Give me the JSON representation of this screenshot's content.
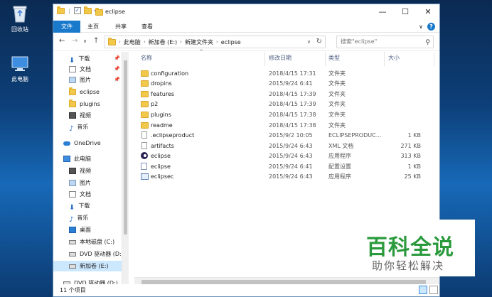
{
  "desktop": {
    "icons": [
      {
        "label": "回收站",
        "icon": "recycle-bin-icon"
      },
      {
        "label": "此电脑",
        "icon": "computer-icon"
      }
    ],
    "watermark": {
      "title": "百科全说",
      "subtitle": "助你轻松解决"
    }
  },
  "window": {
    "title": "eclipse",
    "controls": {
      "minimize": "—",
      "maximize": "☐",
      "close": "✕"
    }
  },
  "ribbon": {
    "tabs": [
      "文件",
      "主页",
      "共享",
      "查看"
    ],
    "expand_glyph": "∨",
    "help_glyph": "?"
  },
  "nav": {
    "back": "←",
    "forward": "→",
    "recent": "∨",
    "up": "↑",
    "breadcrumb": [
      "此电脑",
      "新加卷 (E:)",
      "新建文件夹",
      "eclipse"
    ],
    "refresh": "↻",
    "search_placeholder": "搜索\"eclipse\""
  },
  "sidebar": {
    "items": [
      {
        "label": "下载",
        "pinned": true
      },
      {
        "label": "文档",
        "pinned": true
      },
      {
        "label": "图片",
        "pinned": true
      },
      {
        "label": "eclipse",
        "pinned": false
      },
      {
        "label": "plugins",
        "pinned": false
      },
      {
        "label": "视频",
        "pinned": false
      },
      {
        "label": "音乐",
        "pinned": false
      },
      {
        "label": "OneDrive",
        "pinned": false
      },
      {
        "label": "此电脑",
        "pinned": false
      },
      {
        "label": "视频",
        "pinned": false
      },
      {
        "label": "图片",
        "pinned": false
      },
      {
        "label": "文档",
        "pinned": false
      },
      {
        "label": "下载",
        "pinned": false
      },
      {
        "label": "音乐",
        "pinned": false
      },
      {
        "label": "桌面",
        "pinned": false
      },
      {
        "label": "本地磁盘 (C:)",
        "pinned": false
      },
      {
        "label": "DVD 驱动器 (D:",
        "pinned": false
      },
      {
        "label": "新加卷 (E:)",
        "pinned": false,
        "selected": true
      },
      {
        "label": "DVD 驱动器 (D:)",
        "pinned": false
      }
    ]
  },
  "list": {
    "columns": {
      "name": "名称",
      "date": "修改日期",
      "type": "类型",
      "size": "大小"
    },
    "rows": [
      {
        "name": "configuration",
        "date": "2018/4/15 17:31",
        "type": "文件夹",
        "size": "",
        "icon": "folder"
      },
      {
        "name": "dropins",
        "date": "2015/9/24 6:41",
        "type": "文件夹",
        "size": "",
        "icon": "folder"
      },
      {
        "name": "features",
        "date": "2018/4/15 17:39",
        "type": "文件夹",
        "size": "",
        "icon": "folder"
      },
      {
        "name": "p2",
        "date": "2018/4/15 17:39",
        "type": "文件夹",
        "size": "",
        "icon": "folder"
      },
      {
        "name": "plugins",
        "date": "2018/4/15 17:38",
        "type": "文件夹",
        "size": "",
        "icon": "folder"
      },
      {
        "name": "readme",
        "date": "2018/4/15 17:38",
        "type": "文件夹",
        "size": "",
        "icon": "folder"
      },
      {
        "name": ".eclipseproduct",
        "date": "2015/9/2 10:05",
        "type": "ECLIPSEPRODUC...",
        "size": "1 KB",
        "icon": "file"
      },
      {
        "name": "artifacts",
        "date": "2015/9/24 6:43",
        "type": "XML 文档",
        "size": "271 KB",
        "icon": "file"
      },
      {
        "name": "eclipse",
        "date": "2015/9/24 6:43",
        "type": "应用程序",
        "size": "313 KB",
        "icon": "eclipse"
      },
      {
        "name": "eclipse",
        "date": "2015/9/24 6:41",
        "type": "配置设置",
        "size": "1 KB",
        "icon": "ini"
      },
      {
        "name": "eclipsec",
        "date": "2015/9/24 6:43",
        "type": "应用程序",
        "size": "25 KB",
        "icon": "exe"
      }
    ]
  },
  "status": {
    "item_count": "11 个项目"
  }
}
